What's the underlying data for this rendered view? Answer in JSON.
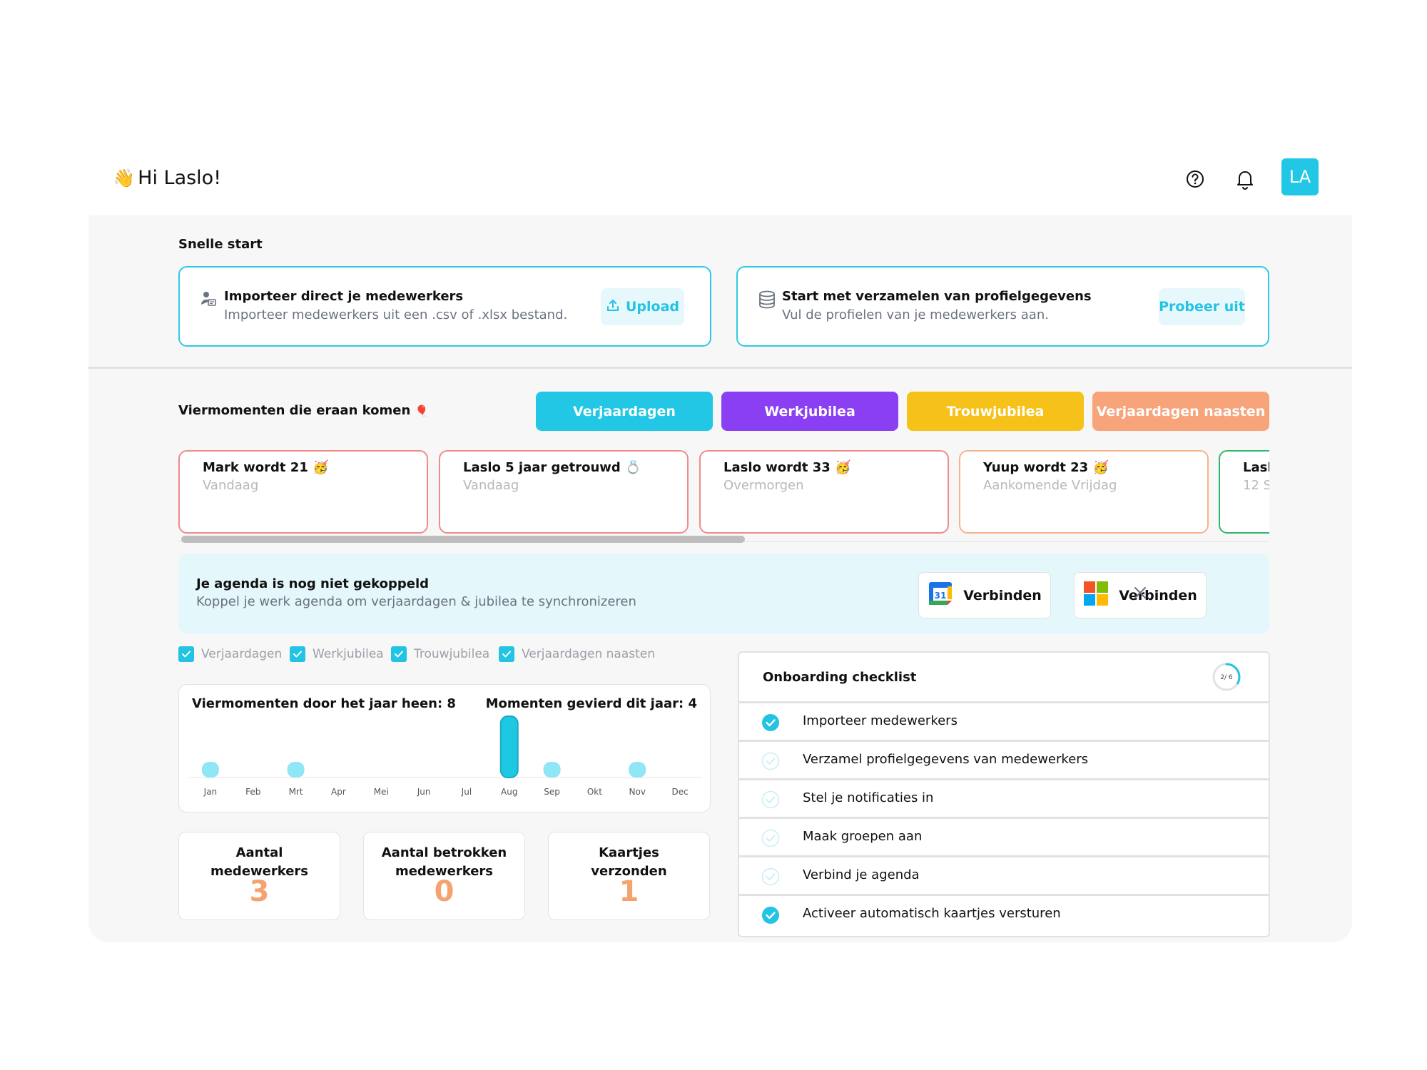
{
  "header": {
    "greeting": "Hi Laslo!",
    "wave_emoji": "👋",
    "avatar_initials": "LA",
    "help_icon": "help-circle-icon",
    "bell_icon": "bell-icon"
  },
  "quick_start": {
    "title": "Snelle start",
    "cards": [
      {
        "title": "Importeer direct je medewerkers",
        "subtitle": "Importeer medewerkers uit een .csv of .xlsx bestand.",
        "button": "Upload",
        "icon": "user-import-icon",
        "button_icon": "upload-icon"
      },
      {
        "title": "Start met verzamelen van profielgegevens",
        "subtitle": "Vul de profielen van je medewerkers aan.",
        "button": "Probeer uit",
        "icon": "database-icon"
      }
    ]
  },
  "moments": {
    "title": "Viermomenten die eraan komen",
    "title_emoji": "🎈",
    "filters": [
      {
        "label": "Verjaardagen",
        "color": "#22c7e6"
      },
      {
        "label": "Werkjubilea",
        "color": "#8b3ff2"
      },
      {
        "label": "Trouwjubilea",
        "color": "#f6c21a"
      },
      {
        "label": "Verjaardagen naasten",
        "color": "#f7a47b"
      }
    ],
    "cards": [
      {
        "title": "Mark  wordt 21 🥳",
        "subtitle": "Vandaag",
        "border": "#f08b8b"
      },
      {
        "title": "Laslo 5 jaar getrouwd 💍",
        "subtitle": "Vandaag",
        "border": "#f08b8b"
      },
      {
        "title": "Laslo  wordt 33 🥳",
        "subtitle": "Overmorgen",
        "border": "#f08b8b"
      },
      {
        "title": "Yuup  wordt 23 🥳",
        "subtitle": "Aankomende Vrijdag",
        "border": "#f7b48b"
      },
      {
        "title": "Laslo",
        "subtitle": "12 S",
        "border": "#2fb86a"
      }
    ]
  },
  "calendar_banner": {
    "title": "Je agenda is nog niet gekoppeld",
    "subtitle": "Koppel je werk agenda om verjaardagen & jubilea te synchronizeren",
    "google_button": "Verbinden",
    "google_icon": "google-calendar-icon",
    "google_day": "31",
    "microsoft_button": "Verbinden",
    "microsoft_icon": "microsoft-icon",
    "close_icon": "close-icon"
  },
  "legend": [
    {
      "label": "Verjaardagen",
      "checked": true
    },
    {
      "label": "Werkjubilea",
      "checked": true
    },
    {
      "label": "Trouwjubilea",
      "checked": true
    },
    {
      "label": "Verjaardagen naasten",
      "checked": true
    }
  ],
  "chart": {
    "title_left": "Viermomenten door het jaar heen: 8",
    "title_right": "Momenten gevierd dit jaar: 4"
  },
  "chart_data": {
    "type": "bar",
    "categories": [
      "Jan",
      "Feb",
      "Mrt",
      "Apr",
      "Mei",
      "Jun",
      "Jul",
      "Aug",
      "Sep",
      "Okt",
      "Nov",
      "Dec"
    ],
    "values": [
      1,
      0,
      1,
      0,
      0,
      0,
      0,
      4,
      1,
      0,
      1,
      0
    ],
    "highlight_index": 7,
    "colors": {
      "default": "#8fe6f5",
      "highlight": "#1ec8e3"
    },
    "title": "Viermomenten door het jaar heen: 8",
    "ylim": [
      0,
      4
    ],
    "grid": false
  },
  "stats": [
    {
      "label": "Aantal medewerkers",
      "value": "3"
    },
    {
      "label": "Aantal betrokken medewerkers",
      "value": "0"
    },
    {
      "label": "Kaartjes verzonden",
      "value": "1"
    }
  ],
  "checklist": {
    "title": "Onboarding checklist",
    "progress_label": "2/ 6",
    "progress": 0.333,
    "items": [
      {
        "label": "Importeer medewerkers",
        "done": true
      },
      {
        "label": "Verzamel profielgegevens van medewerkers",
        "done": false
      },
      {
        "label": "Stel je notificaties in",
        "done": false
      },
      {
        "label": "Maak groepen aan",
        "done": false
      },
      {
        "label": "Verbind je agenda",
        "done": false
      },
      {
        "label": "Activeer automatisch kaartjes versturen",
        "done": true
      }
    ]
  }
}
